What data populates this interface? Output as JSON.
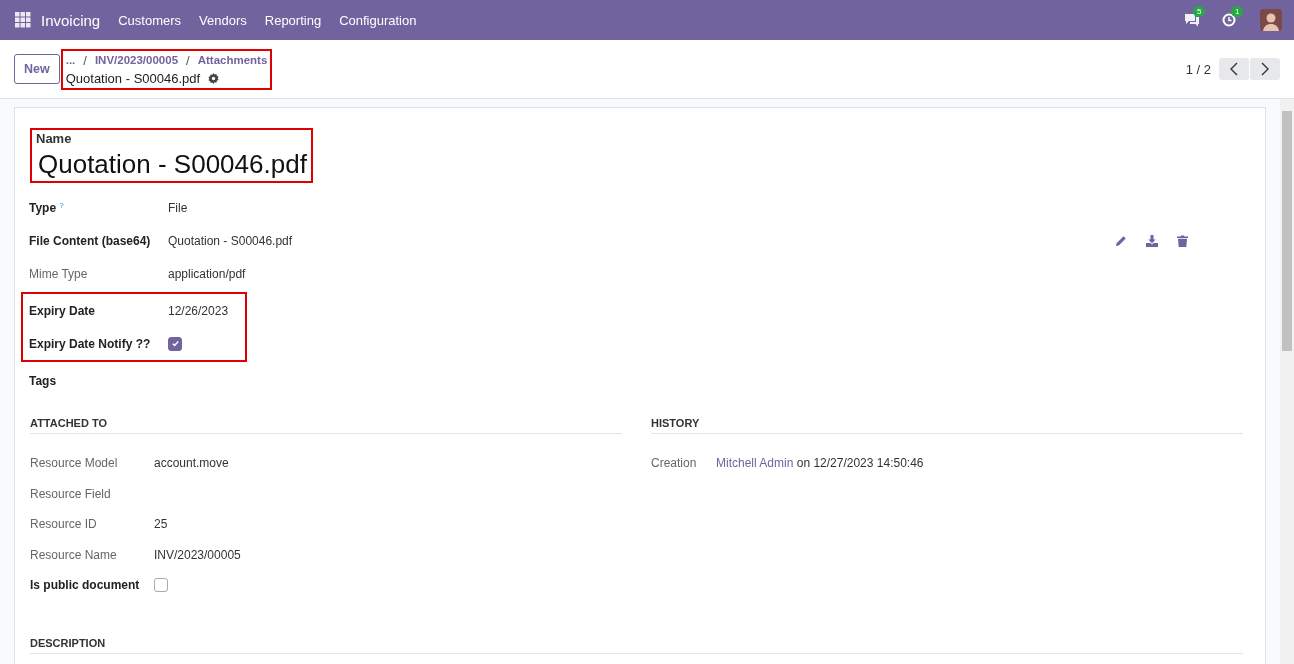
{
  "navbar": {
    "app_name": "Invoicing",
    "menu": [
      "Customers",
      "Vendors",
      "Reporting",
      "Configuration"
    ],
    "messages_count": "5",
    "activities_count": "1"
  },
  "control_panel": {
    "new_button": "New",
    "breadcrumb": {
      "highlighted": true,
      "ellipsis": "...",
      "separator": "/",
      "items": [
        "INV/2023/00005",
        "Attachments"
      ],
      "current": "Quotation - S00046.pdf"
    },
    "pager": "1 / 2"
  },
  "name": {
    "highlighted": true,
    "label": "Name",
    "value": "Quotation - S00046.pdf"
  },
  "field_groups": [
    {
      "highlighted": false,
      "fields": [
        {
          "kind": "text",
          "label": "Type",
          "bold": true,
          "help_mark": "?",
          "value": "File"
        },
        {
          "kind": "file",
          "label": "File Content (base64)",
          "bold": true,
          "value": "Quotation - S00046.pdf"
        },
        {
          "kind": "text",
          "label": "Mime Type",
          "bold": false,
          "value": "application/pdf"
        }
      ]
    },
    {
      "highlighted": true,
      "fields": [
        {
          "kind": "text",
          "label": "Expiry Date",
          "bold": true,
          "value": "12/26/2023"
        },
        {
          "kind": "checkbox",
          "label": "Expiry Date Notify ??",
          "bold": true,
          "checked": true
        }
      ]
    },
    {
      "highlighted": false,
      "fields": [
        {
          "kind": "text",
          "label": "Tags",
          "bold": true
        }
      ]
    }
  ],
  "attached_to": {
    "title": "ATTACHED TO",
    "fields": [
      {
        "kind": "text",
        "label": "Resource Model",
        "bold": false,
        "value": "account.move"
      },
      {
        "kind": "text",
        "label": "Resource Field",
        "bold": false
      },
      {
        "kind": "text",
        "label": "Resource ID",
        "bold": false,
        "value": "25"
      },
      {
        "kind": "text",
        "label": "Resource Name",
        "bold": false,
        "value": "INV/2023/00005"
      },
      {
        "kind": "checkbox",
        "label": "Is public document",
        "bold": true,
        "checked": false
      }
    ]
  },
  "history": {
    "title": "HISTORY",
    "label": "Creation",
    "user": "Mitchell Admin",
    "rest": "on 12/27/2023 14:50:46"
  },
  "description": {
    "title": "DESCRIPTION"
  }
}
